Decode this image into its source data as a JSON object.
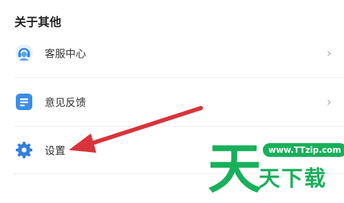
{
  "section": {
    "title": "关于其他"
  },
  "menu": {
    "items": [
      {
        "label": "客服中心",
        "icon": "headset-icon",
        "has_chevron": true
      },
      {
        "label": "意见反馈",
        "icon": "feedback-doc-icon",
        "has_chevron": true
      },
      {
        "label": "设置",
        "icon": "gear-icon",
        "has_chevron": false
      }
    ],
    "chevron": "›"
  },
  "annotation": {
    "type": "arrow",
    "color": "#d9333b",
    "points_to": "设置"
  },
  "watermark": {
    "url": "www.TTzip.com",
    "text": "天下载",
    "logo_glyph": "天",
    "color": "#18b05a"
  },
  "colors": {
    "accent_blue": "#3a8ee6",
    "divider": "#ececec"
  }
}
